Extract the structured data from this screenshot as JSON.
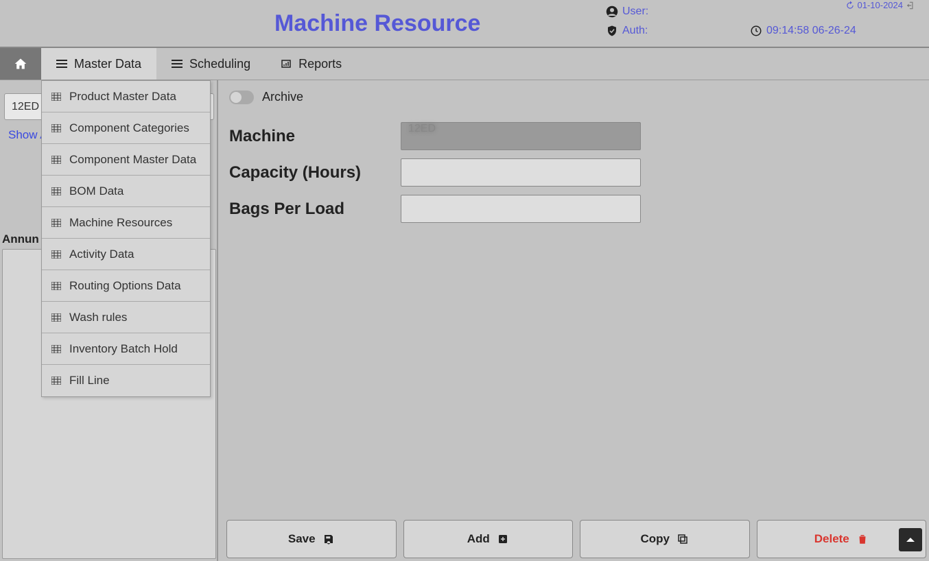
{
  "header": {
    "title": "Machine Resource",
    "user_label": "User:",
    "auth_label": "Auth:",
    "clock_text": "09:14:58 06-26-24",
    "date_text": "01-10-2024"
  },
  "nav": {
    "master_data": "Master Data",
    "scheduling": "Scheduling",
    "reports": "Reports"
  },
  "dropdown": {
    "items": [
      "Product Master Data",
      "Component Categories",
      "Component Master Data",
      "BOM Data",
      "Machine Resources",
      "Activity Data",
      "Routing Options Data",
      "Wash rules",
      "Inventory Batch Hold",
      "Fill Line"
    ]
  },
  "left": {
    "search_value": "12ED",
    "show_archived": "Show Archived",
    "annun_label": "Annun"
  },
  "form": {
    "archive_label": "Archive",
    "machine_label": "Machine",
    "machine_value": "12ED",
    "capacity_label": "Capacity (Hours)",
    "capacity_value": "  ",
    "bags_label": "Bags Per Load",
    "bags_value": "  "
  },
  "footer": {
    "save": "Save",
    "add": "Add",
    "copy": "Copy",
    "delete": "Delete"
  }
}
